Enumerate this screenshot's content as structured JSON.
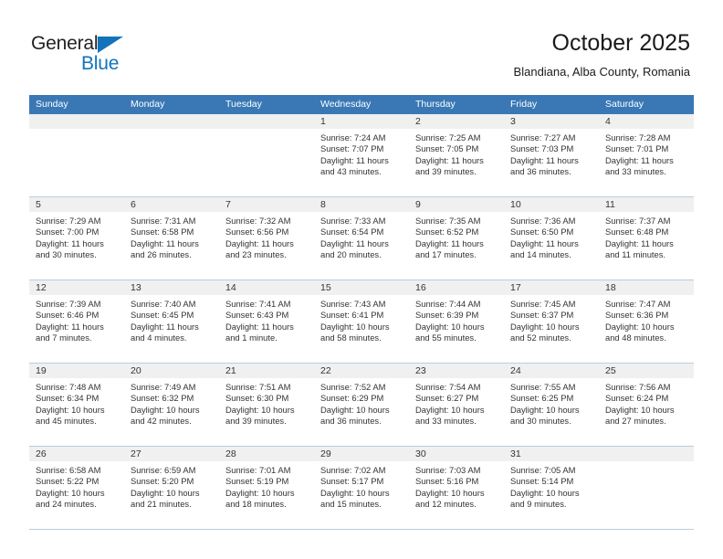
{
  "brand": {
    "name_top": "General",
    "name_bottom": "Blue",
    "color_blue": "#1273bb",
    "color_dark": "#231f20"
  },
  "header": {
    "title": "October 2025",
    "subtitle": "Blandiana, Alba County, Romania"
  },
  "theme": {
    "header_blue": "#3a78b5",
    "date_strip_gray": "#f0f0f0",
    "row_border": "#b9cde0"
  },
  "weekdays": [
    "Sunday",
    "Monday",
    "Tuesday",
    "Wednesday",
    "Thursday",
    "Friday",
    "Saturday"
  ],
  "weeks": [
    [
      {
        "day": "",
        "empty": true
      },
      {
        "day": "",
        "empty": true
      },
      {
        "day": "",
        "empty": true
      },
      {
        "day": "1",
        "sunrise": "Sunrise: 7:24 AM",
        "sunset": "Sunset: 7:07 PM",
        "daylight1": "Daylight: 11 hours",
        "daylight2": "and 43 minutes."
      },
      {
        "day": "2",
        "sunrise": "Sunrise: 7:25 AM",
        "sunset": "Sunset: 7:05 PM",
        "daylight1": "Daylight: 11 hours",
        "daylight2": "and 39 minutes."
      },
      {
        "day": "3",
        "sunrise": "Sunrise: 7:27 AM",
        "sunset": "Sunset: 7:03 PM",
        "daylight1": "Daylight: 11 hours",
        "daylight2": "and 36 minutes."
      },
      {
        "day": "4",
        "sunrise": "Sunrise: 7:28 AM",
        "sunset": "Sunset: 7:01 PM",
        "daylight1": "Daylight: 11 hours",
        "daylight2": "and 33 minutes."
      }
    ],
    [
      {
        "day": "5",
        "sunrise": "Sunrise: 7:29 AM",
        "sunset": "Sunset: 7:00 PM",
        "daylight1": "Daylight: 11 hours",
        "daylight2": "and 30 minutes."
      },
      {
        "day": "6",
        "sunrise": "Sunrise: 7:31 AM",
        "sunset": "Sunset: 6:58 PM",
        "daylight1": "Daylight: 11 hours",
        "daylight2": "and 26 minutes."
      },
      {
        "day": "7",
        "sunrise": "Sunrise: 7:32 AM",
        "sunset": "Sunset: 6:56 PM",
        "daylight1": "Daylight: 11 hours",
        "daylight2": "and 23 minutes."
      },
      {
        "day": "8",
        "sunrise": "Sunrise: 7:33 AM",
        "sunset": "Sunset: 6:54 PM",
        "daylight1": "Daylight: 11 hours",
        "daylight2": "and 20 minutes."
      },
      {
        "day": "9",
        "sunrise": "Sunrise: 7:35 AM",
        "sunset": "Sunset: 6:52 PM",
        "daylight1": "Daylight: 11 hours",
        "daylight2": "and 17 minutes."
      },
      {
        "day": "10",
        "sunrise": "Sunrise: 7:36 AM",
        "sunset": "Sunset: 6:50 PM",
        "daylight1": "Daylight: 11 hours",
        "daylight2": "and 14 minutes."
      },
      {
        "day": "11",
        "sunrise": "Sunrise: 7:37 AM",
        "sunset": "Sunset: 6:48 PM",
        "daylight1": "Daylight: 11 hours",
        "daylight2": "and 11 minutes."
      }
    ],
    [
      {
        "day": "12",
        "sunrise": "Sunrise: 7:39 AM",
        "sunset": "Sunset: 6:46 PM",
        "daylight1": "Daylight: 11 hours",
        "daylight2": "and 7 minutes."
      },
      {
        "day": "13",
        "sunrise": "Sunrise: 7:40 AM",
        "sunset": "Sunset: 6:45 PM",
        "daylight1": "Daylight: 11 hours",
        "daylight2": "and 4 minutes."
      },
      {
        "day": "14",
        "sunrise": "Sunrise: 7:41 AM",
        "sunset": "Sunset: 6:43 PM",
        "daylight1": "Daylight: 11 hours",
        "daylight2": "and 1 minute."
      },
      {
        "day": "15",
        "sunrise": "Sunrise: 7:43 AM",
        "sunset": "Sunset: 6:41 PM",
        "daylight1": "Daylight: 10 hours",
        "daylight2": "and 58 minutes."
      },
      {
        "day": "16",
        "sunrise": "Sunrise: 7:44 AM",
        "sunset": "Sunset: 6:39 PM",
        "daylight1": "Daylight: 10 hours",
        "daylight2": "and 55 minutes."
      },
      {
        "day": "17",
        "sunrise": "Sunrise: 7:45 AM",
        "sunset": "Sunset: 6:37 PM",
        "daylight1": "Daylight: 10 hours",
        "daylight2": "and 52 minutes."
      },
      {
        "day": "18",
        "sunrise": "Sunrise: 7:47 AM",
        "sunset": "Sunset: 6:36 PM",
        "daylight1": "Daylight: 10 hours",
        "daylight2": "and 48 minutes."
      }
    ],
    [
      {
        "day": "19",
        "sunrise": "Sunrise: 7:48 AM",
        "sunset": "Sunset: 6:34 PM",
        "daylight1": "Daylight: 10 hours",
        "daylight2": "and 45 minutes."
      },
      {
        "day": "20",
        "sunrise": "Sunrise: 7:49 AM",
        "sunset": "Sunset: 6:32 PM",
        "daylight1": "Daylight: 10 hours",
        "daylight2": "and 42 minutes."
      },
      {
        "day": "21",
        "sunrise": "Sunrise: 7:51 AM",
        "sunset": "Sunset: 6:30 PM",
        "daylight1": "Daylight: 10 hours",
        "daylight2": "and 39 minutes."
      },
      {
        "day": "22",
        "sunrise": "Sunrise: 7:52 AM",
        "sunset": "Sunset: 6:29 PM",
        "daylight1": "Daylight: 10 hours",
        "daylight2": "and 36 minutes."
      },
      {
        "day": "23",
        "sunrise": "Sunrise: 7:54 AM",
        "sunset": "Sunset: 6:27 PM",
        "daylight1": "Daylight: 10 hours",
        "daylight2": "and 33 minutes."
      },
      {
        "day": "24",
        "sunrise": "Sunrise: 7:55 AM",
        "sunset": "Sunset: 6:25 PM",
        "daylight1": "Daylight: 10 hours",
        "daylight2": "and 30 minutes."
      },
      {
        "day": "25",
        "sunrise": "Sunrise: 7:56 AM",
        "sunset": "Sunset: 6:24 PM",
        "daylight1": "Daylight: 10 hours",
        "daylight2": "and 27 minutes."
      }
    ],
    [
      {
        "day": "26",
        "sunrise": "Sunrise: 6:58 AM",
        "sunset": "Sunset: 5:22 PM",
        "daylight1": "Daylight: 10 hours",
        "daylight2": "and 24 minutes."
      },
      {
        "day": "27",
        "sunrise": "Sunrise: 6:59 AM",
        "sunset": "Sunset: 5:20 PM",
        "daylight1": "Daylight: 10 hours",
        "daylight2": "and 21 minutes."
      },
      {
        "day": "28",
        "sunrise": "Sunrise: 7:01 AM",
        "sunset": "Sunset: 5:19 PM",
        "daylight1": "Daylight: 10 hours",
        "daylight2": "and 18 minutes."
      },
      {
        "day": "29",
        "sunrise": "Sunrise: 7:02 AM",
        "sunset": "Sunset: 5:17 PM",
        "daylight1": "Daylight: 10 hours",
        "daylight2": "and 15 minutes."
      },
      {
        "day": "30",
        "sunrise": "Sunrise: 7:03 AM",
        "sunset": "Sunset: 5:16 PM",
        "daylight1": "Daylight: 10 hours",
        "daylight2": "and 12 minutes."
      },
      {
        "day": "31",
        "sunrise": "Sunrise: 7:05 AM",
        "sunset": "Sunset: 5:14 PM",
        "daylight1": "Daylight: 10 hours",
        "daylight2": "and 9 minutes."
      },
      {
        "day": "",
        "empty": true
      }
    ]
  ]
}
